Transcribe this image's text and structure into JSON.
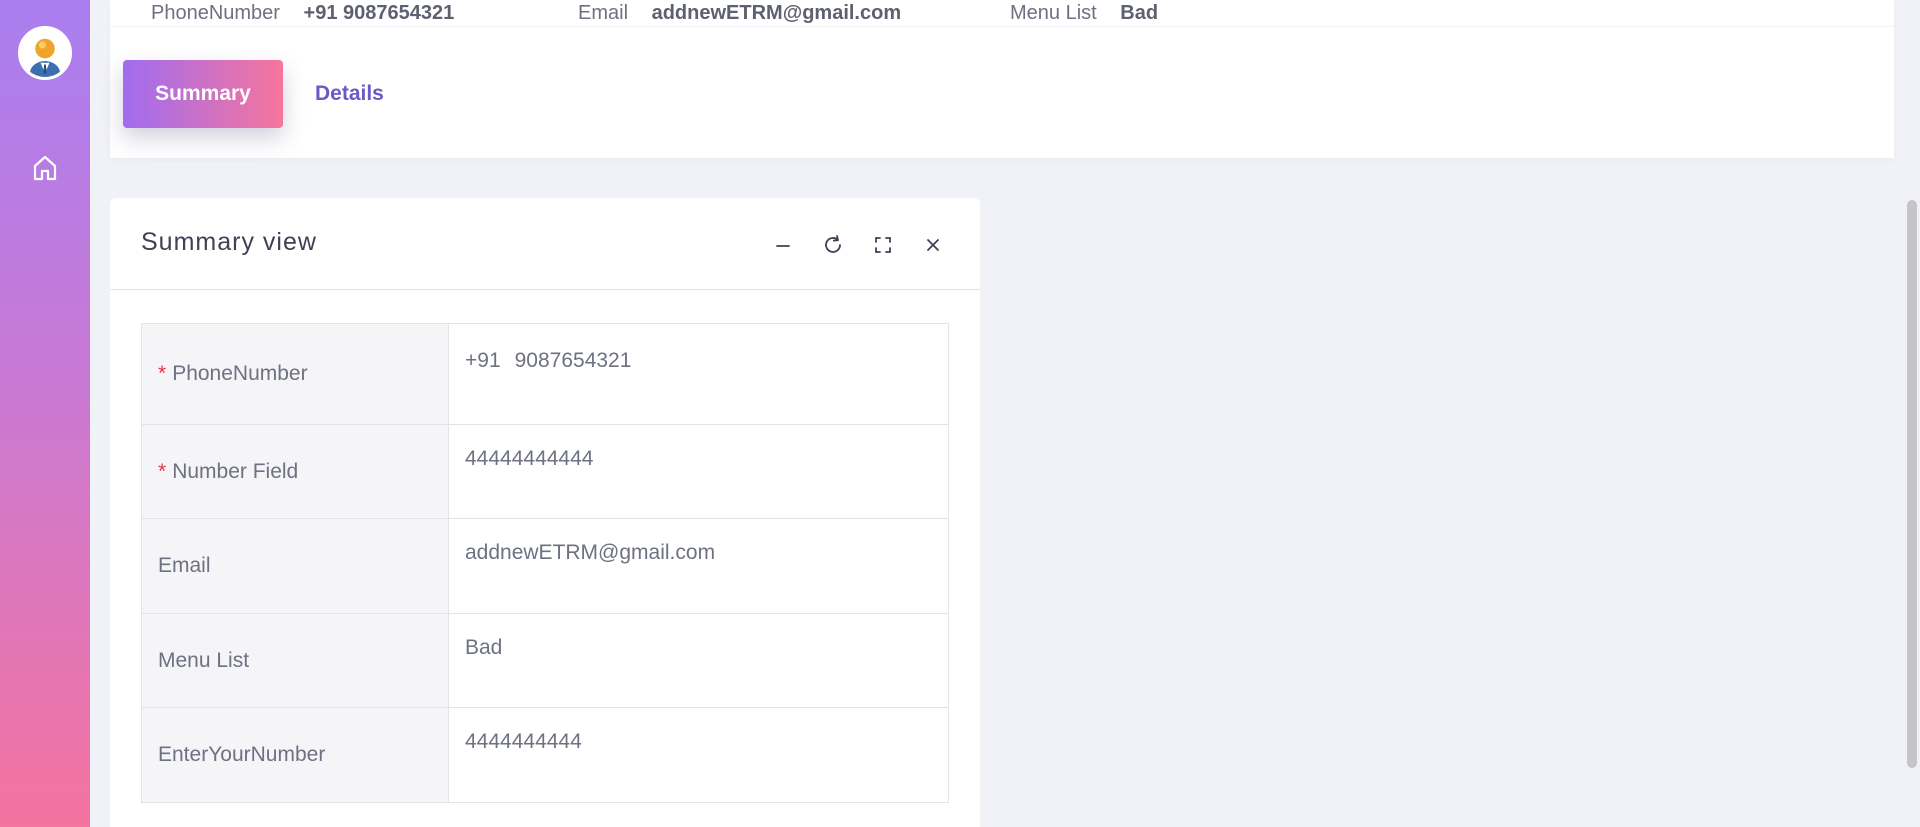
{
  "sidebar": {
    "avatar_icon": "user-avatar-icon",
    "home_icon": "home-icon",
    "gradient": [
      "#a97ef0",
      "#f4739f"
    ]
  },
  "header_info": {
    "phone_label": "PhoneNumber",
    "phone_value": "+91 9087654321",
    "email_label": "Email",
    "email_value": "addnewETRM@gmail.com",
    "menu_label": "Menu List",
    "menu_value": "Bad"
  },
  "tabs": {
    "summary_label": "Summary",
    "details_label": "Details",
    "active": "Summary"
  },
  "summary_card": {
    "title": "Summary view",
    "tools": [
      "minimize-icon",
      "refresh-icon",
      "fullscreen-icon",
      "close-icon"
    ],
    "rows": [
      {
        "label": "PhoneNumber",
        "required": "*",
        "code": "+91",
        "value": "9087654321"
      },
      {
        "label": "Number Field",
        "required": "*",
        "value": "44444444444"
      },
      {
        "label": "Email",
        "value": "addnewETRM@gmail.com"
      },
      {
        "label": "Menu List",
        "value": "Bad"
      },
      {
        "label": "EnterYourNumber",
        "value": "4444444444"
      }
    ]
  },
  "colors": {
    "accent": "#6a5ac8",
    "required": "#e4344c",
    "background": "#f1f2f7"
  }
}
